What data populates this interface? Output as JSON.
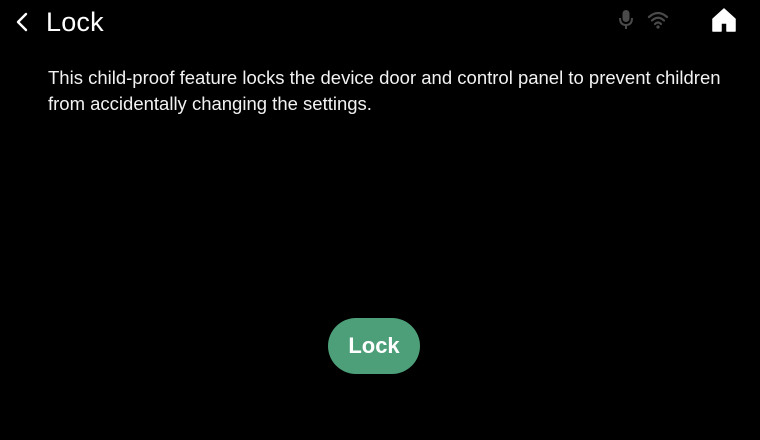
{
  "header": {
    "back_icon": "chevron-left-icon",
    "title": "Lock",
    "status_icons": [
      "microphone-icon",
      "wifi-icon"
    ],
    "home_icon": "home-icon"
  },
  "main": {
    "description": "This child-proof feature locks the device door and control panel to prevent children from accidentally changing the settings.",
    "lock_button_label": "Lock"
  },
  "colors": {
    "background": "#000000",
    "text": "#ffffff",
    "status_icon": "#555555",
    "accent_button": "#4c9f78"
  }
}
